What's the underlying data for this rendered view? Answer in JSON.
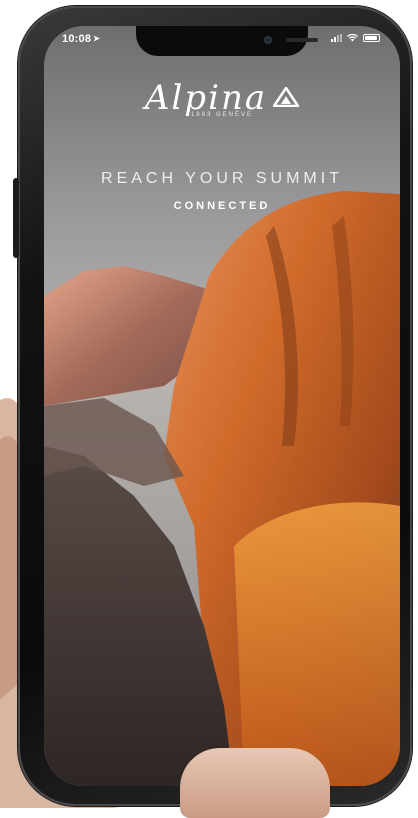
{
  "status_bar": {
    "time": "10:08",
    "location_icon": "location-arrow-icon",
    "signal_icon": "cellular-signal-icon",
    "wifi_icon": "wifi-icon",
    "battery_icon": "battery-icon"
  },
  "brand": {
    "name": "Alpina",
    "tagline_small": "1883 GENÈVE",
    "logo_icon": "triangle-logo-icon"
  },
  "hero": {
    "headline": "REACH YOUR SUMMIT",
    "subheadline": "CONNECTED"
  },
  "colors": {
    "text": "#ffffff",
    "sky_top": "#7a7a7a",
    "rock_orange": "#d9762a",
    "rock_dark": "#4a3a33",
    "phone_frame": "#111111"
  }
}
